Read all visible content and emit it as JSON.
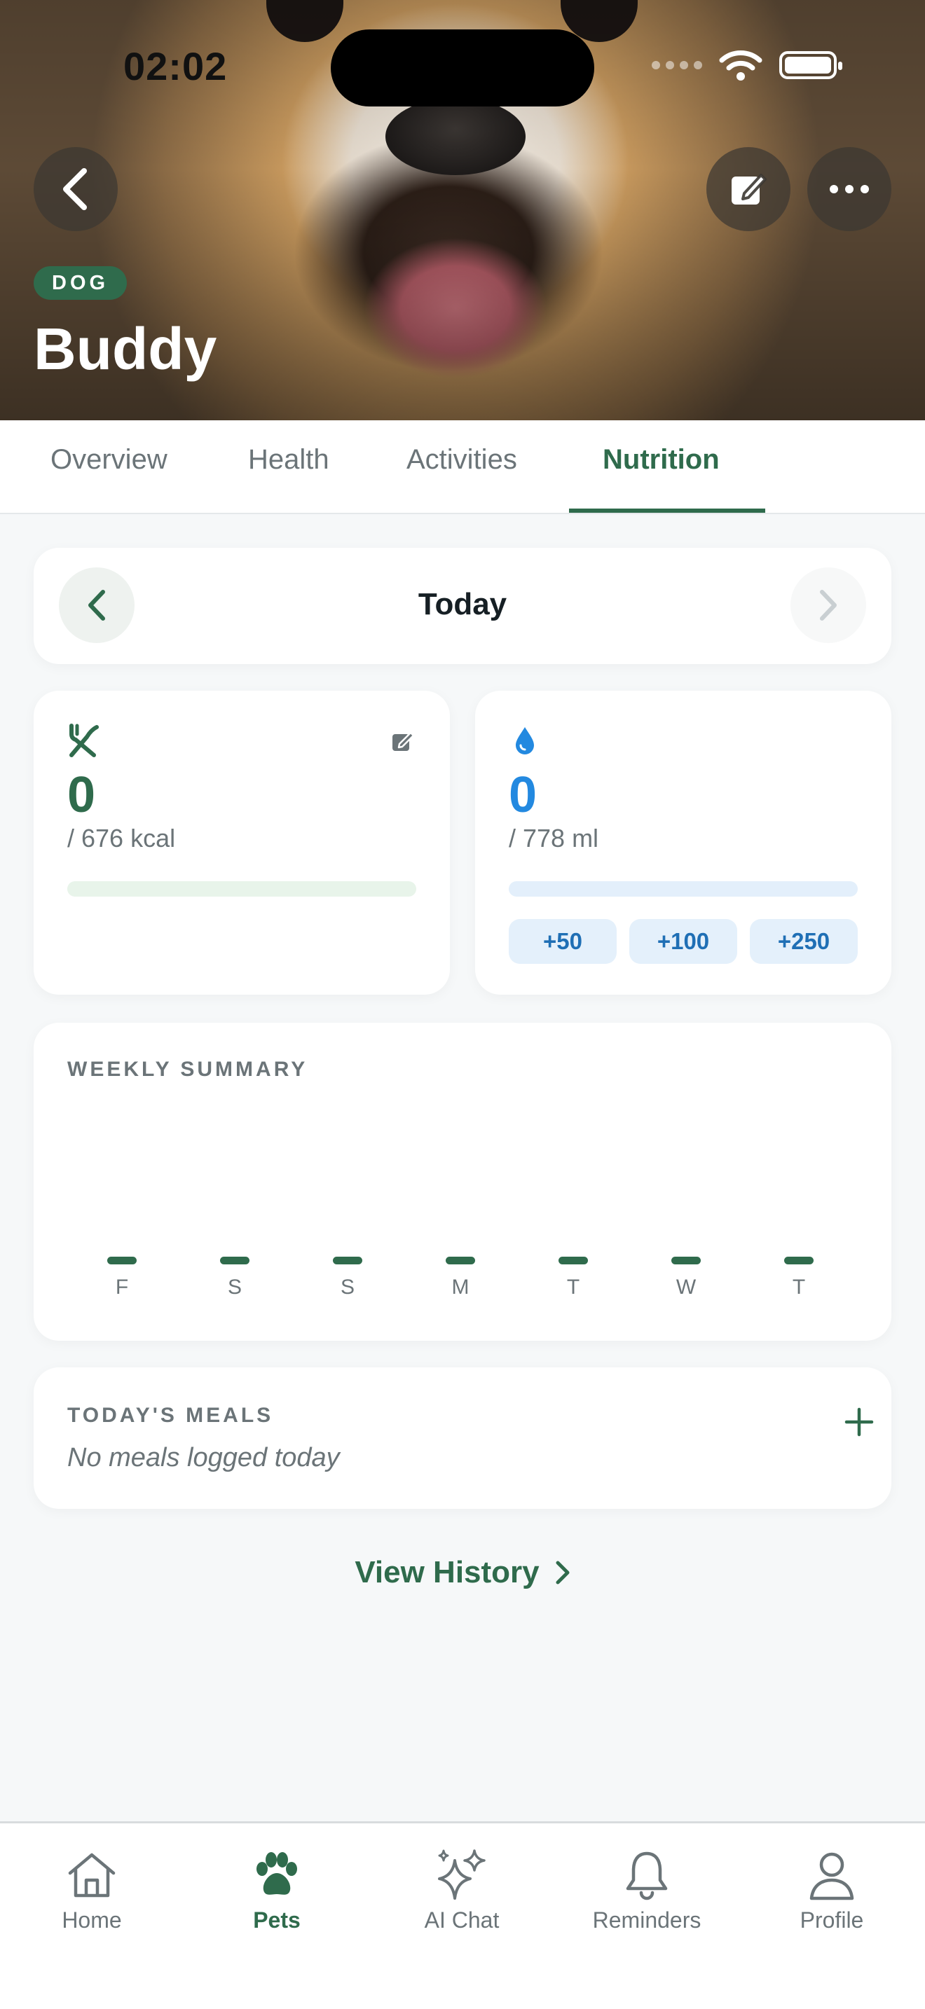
{
  "status_bar": {
    "time": "02:02"
  },
  "pet": {
    "type_badge": "DOG",
    "name": "Buddy"
  },
  "header_actions": {
    "back": "back-icon",
    "edit": "edit-icon",
    "more": "more-icon"
  },
  "tabs": [
    {
      "label": "Overview"
    },
    {
      "label": "Health"
    },
    {
      "label": "Activities"
    },
    {
      "label": "Nutrition",
      "active": true
    }
  ],
  "date_nav": {
    "label": "Today"
  },
  "calories": {
    "value": "0",
    "goal": "/ 676 kcal",
    "progress": 0,
    "color": "#2f6b4c",
    "track": "#e8f4ea"
  },
  "water": {
    "value": "0",
    "goal": "/ 778 ml",
    "progress": 0,
    "color": "#2389e0",
    "track": "#e3effb",
    "quick_add": [
      "+50",
      "+100",
      "+250"
    ]
  },
  "weekly_summary": {
    "title": "WEEKLY SUMMARY",
    "days": [
      {
        "label": "F",
        "value": 0
      },
      {
        "label": "S",
        "value": 0
      },
      {
        "label": "S",
        "value": 0
      },
      {
        "label": "M",
        "value": 0
      },
      {
        "label": "T",
        "value": 0
      },
      {
        "label": "W",
        "value": 0
      },
      {
        "label": "T",
        "value": 0
      }
    ]
  },
  "meals": {
    "title": "TODAY'S MEALS",
    "empty_text": "No meals logged today"
  },
  "history": {
    "label": "View History"
  },
  "bottom_nav": [
    {
      "label": "Home",
      "icon": "home-icon"
    },
    {
      "label": "Pets",
      "icon": "paw-icon",
      "active": true
    },
    {
      "label": "AI Chat",
      "icon": "sparkles-icon"
    },
    {
      "label": "Reminders",
      "icon": "bell-icon"
    },
    {
      "label": "Profile",
      "icon": "user-icon"
    }
  ],
  "colors": {
    "brand": "#2f6b4c",
    "water": "#2389e0",
    "background": "#f6f8f9"
  }
}
